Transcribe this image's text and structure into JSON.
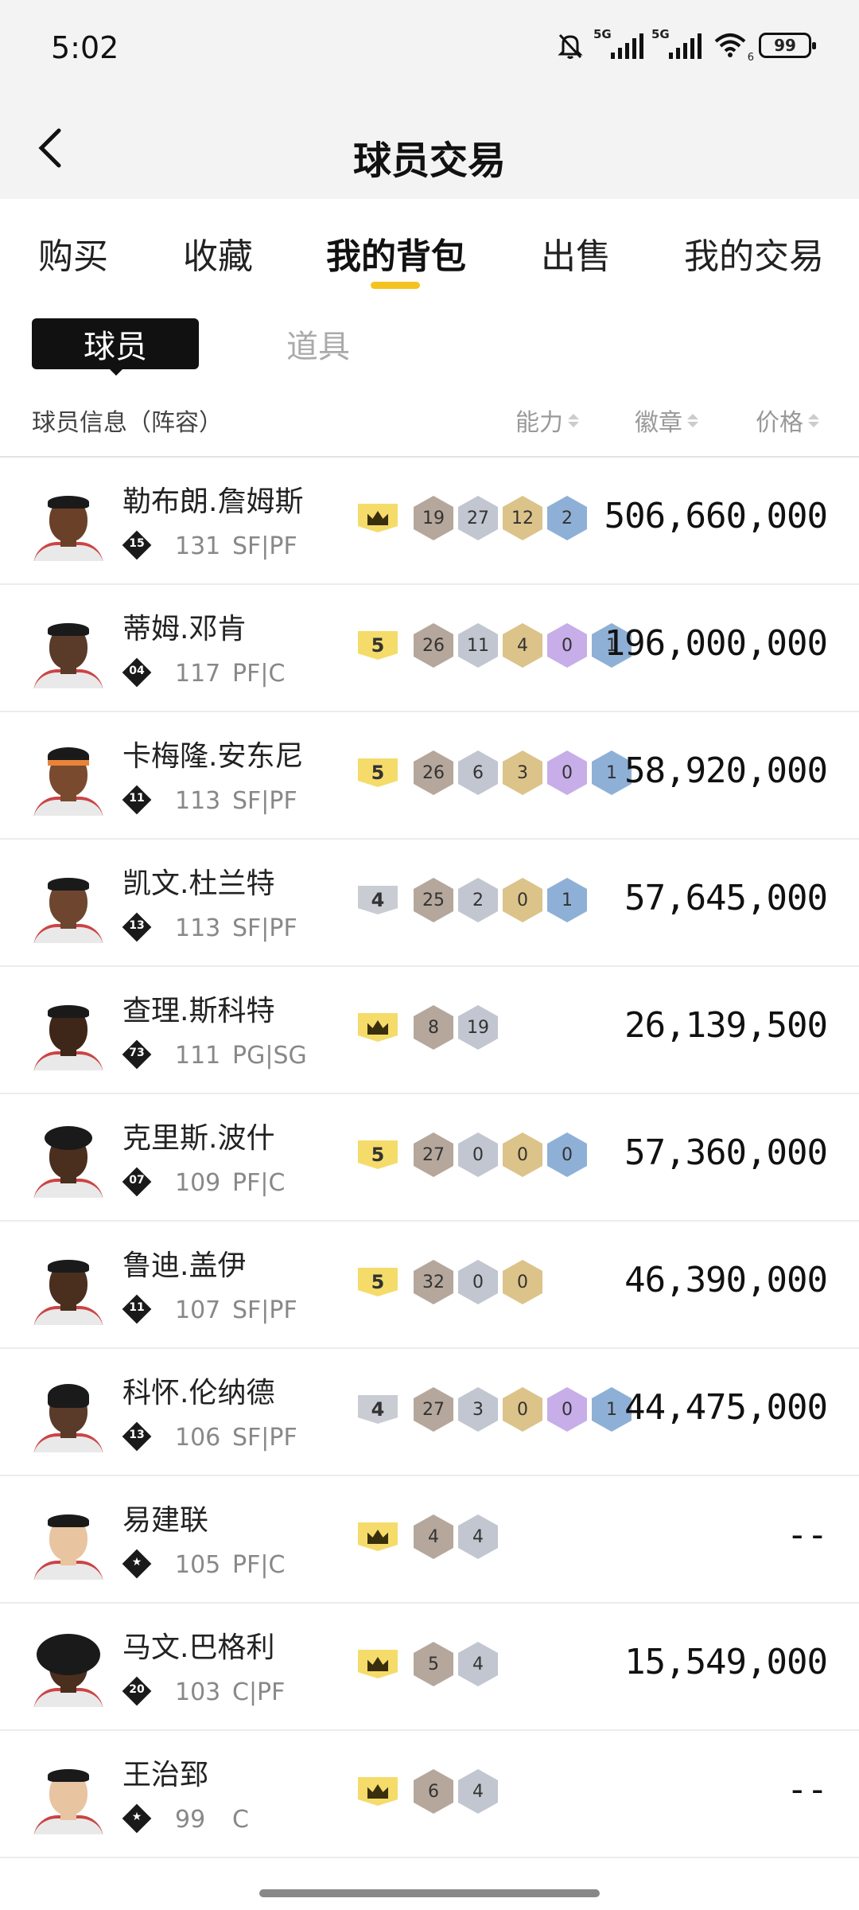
{
  "status_bar": {
    "time": "5:02",
    "signal_1": "5G",
    "signal_2": "5G",
    "wifi_sub": "6",
    "battery": "99"
  },
  "header": {
    "title": "球员交易"
  },
  "tabs": [
    {
      "label": "购买",
      "active": false
    },
    {
      "label": "收藏",
      "active": false
    },
    {
      "label": "我的背包",
      "active": true
    },
    {
      "label": "出售",
      "active": false
    },
    {
      "label": "我的交易",
      "active": false
    }
  ],
  "segments": {
    "players": "球员",
    "items": "道具"
  },
  "columns": {
    "info": "球员信息（阵容）",
    "ability": "能力",
    "badges": "徽章",
    "price": "价格"
  },
  "players": [
    {
      "name": "勒布朗.詹姆斯",
      "jersey": "15",
      "ovr": "131",
      "pos": "SF|PF",
      "tier": "crown",
      "badges": [
        "19",
        "27",
        "12",
        "2"
      ],
      "price": "506,660,000",
      "skin": "#6b4028",
      "hair": "short"
    },
    {
      "name": "蒂姆.邓肯",
      "jersey": "04",
      "ovr": "117",
      "pos": "PF|C",
      "tier": "5",
      "badges": [
        "26",
        "11",
        "4",
        "0",
        "1"
      ],
      "price": "196,000,000",
      "skin": "#5a3a28",
      "hair": "short"
    },
    {
      "name": "卡梅隆.安东尼",
      "jersey": "11",
      "ovr": "113",
      "pos": "SF|PF",
      "tier": "5",
      "badges": [
        "26",
        "6",
        "3",
        "0",
        "1"
      ],
      "price": "58,920,000",
      "skin": "#7a4a2e",
      "hair": "headband"
    },
    {
      "name": "凯文.杜兰特",
      "jersey": "13",
      "ovr": "113",
      "pos": "SF|PF",
      "tier": "4",
      "badges": [
        "25",
        "2",
        "0",
        "1"
      ],
      "price": "57,645,000",
      "skin": "#6e4630",
      "hair": "short"
    },
    {
      "name": "查理.斯科特",
      "jersey": "73",
      "ovr": "111",
      "pos": "PG|SG",
      "tier": "crown",
      "badges": [
        "8",
        "19"
      ],
      "price": "26,139,500",
      "skin": "#3e2618",
      "hair": "short"
    },
    {
      "name": "克里斯.波什",
      "jersey": "07",
      "ovr": "109",
      "pos": "PF|C",
      "tier": "5",
      "badges": [
        "27",
        "0",
        "0",
        "0"
      ],
      "price": "57,360,000",
      "skin": "#4a2e1e",
      "hair": "curly"
    },
    {
      "name": "鲁迪.盖伊",
      "jersey": "11",
      "ovr": "107",
      "pos": "SF|PF",
      "tier": "5",
      "badges": [
        "32",
        "0",
        "0"
      ],
      "price": "46,390,000",
      "skin": "#4a2e1e",
      "hair": "short"
    },
    {
      "name": "科怀.伦纳德",
      "jersey": "13",
      "ovr": "106",
      "pos": "SF|PF",
      "tier": "4",
      "badges": [
        "27",
        "3",
        "0",
        "0",
        "1"
      ],
      "price": "44,475,000",
      "skin": "#5a3a28",
      "hair": "braids"
    },
    {
      "name": "易建联",
      "jersey": "★",
      "ovr": "105",
      "pos": "PF|C",
      "tier": "crown",
      "badges": [
        "4",
        "4"
      ],
      "price": "--",
      "skin": "#e8c4a0",
      "hair": "short"
    },
    {
      "name": "马文.巴格利",
      "jersey": "20",
      "ovr": "103",
      "pos": "C|PF",
      "tier": "crown",
      "badges": [
        "5",
        "4"
      ],
      "price": "15,549,000",
      "skin": "#4a2e1e",
      "hair": "afro"
    },
    {
      "name": "王治郅",
      "jersey": "★",
      "ovr": "99",
      "pos": "C",
      "tier": "crown",
      "badges": [
        "6",
        "4"
      ],
      "price": "--",
      "skin": "#e8c4a0",
      "hair": "short"
    }
  ]
}
